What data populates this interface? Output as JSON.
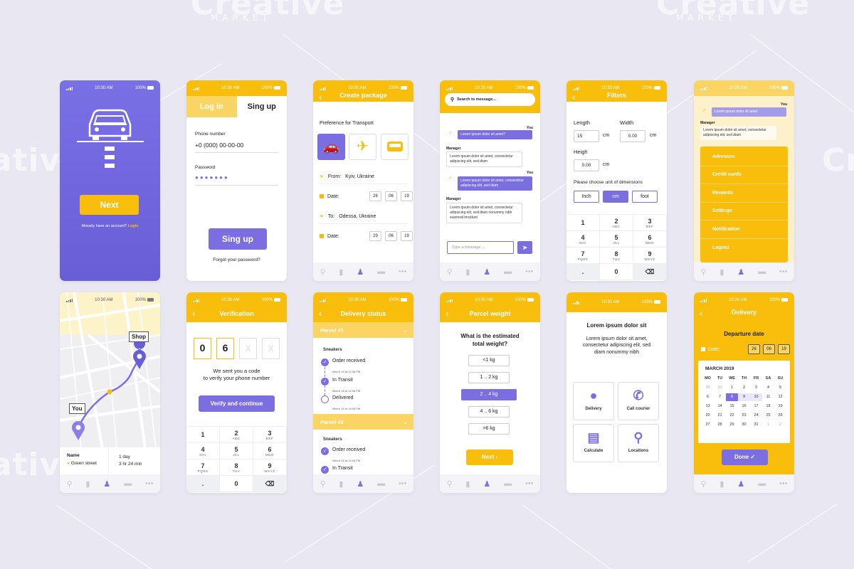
{
  "watermark": {
    "text": "Creative",
    "sub": "MARKET"
  },
  "status_bar": {
    "time": "10:30 AM",
    "battery": "100%"
  },
  "nav_icons": [
    "location-icon",
    "bag-icon",
    "person-icon",
    "car-icon",
    "more-icon"
  ],
  "colors": {
    "yellow": "#f9bd0b",
    "purple": "#7a6ee0",
    "background": "#e9e8f2"
  },
  "s1": {
    "next": "Next",
    "account_text": "Already have an account?",
    "login": "Login"
  },
  "s2": {
    "tab_login": "Log in",
    "tab_signup": "Sing up",
    "phone_label": "Phone number",
    "phone_value": "+0 (000) 00-00-00",
    "password_label": "Password",
    "password_dots": "●●●●●●●",
    "signup_button": "Sing up",
    "forgot": "Forgot your password?"
  },
  "s3": {
    "title": "Create package",
    "pref": "Preference for Transport",
    "from_label": "From:",
    "from_value": "Kyiv, Ukraine",
    "date_label": "Date:",
    "date1": [
      "26",
      "06",
      "19"
    ],
    "to_label": "To:",
    "to_value": "Odessa, Ukraine",
    "date2": [
      "29",
      "06",
      "19"
    ]
  },
  "s4": {
    "search_placeholder": "Search to message...",
    "you": "You",
    "msg_you": "Lorem ipsum dolor sit amet?",
    "manager": "Manager",
    "msg_manager": "Lorem ipsum dolor sit amet, consectetur adipiscing elit, sed diam",
    "you2": "You",
    "msg_you2": "Lorem ipsum dolor sit amet, consectetur adipiscing elit, sed diam",
    "manager2": "Manager",
    "msg_manager2": "Lorem ipsum dolor sit amet, consectetur adipiscing elit, sed diam nonummy nibh euismod tincidunt",
    "input_placeholder": "Type a message ..."
  },
  "s5": {
    "title": "Filters",
    "length_label": "Length",
    "length_value": "15",
    "cm": "cm",
    "width_label": "Width",
    "width_value": "0.00",
    "height_label": "Heigh",
    "height_value": "0.00",
    "units_label": "Please choose unit of dimensions",
    "unit_inch": "Inch",
    "unit_cm": "cm",
    "unit_foot": "foot"
  },
  "keypad": [
    {
      "d": "1",
      "l": ""
    },
    {
      "d": "2",
      "l": "ABC"
    },
    {
      "d": "3",
      "l": "DEF"
    },
    {
      "d": "4",
      "l": "GHI"
    },
    {
      "d": "5",
      "l": "JKL"
    },
    {
      "d": "6",
      "l": "MNO"
    },
    {
      "d": "7",
      "l": "PQRS"
    },
    {
      "d": "8",
      "l": "TUV"
    },
    {
      "d": "9",
      "l": "WXYZ"
    },
    {
      "d": ".",
      "l": ""
    },
    {
      "d": "0",
      "l": ""
    },
    {
      "d": "⌫",
      "l": ""
    }
  ],
  "s6": {
    "you": "You",
    "msg": "Lorem ipsum dolor sit amet",
    "manager": "Manager",
    "msg_manager": "Lorem ipsum dolor sit amet, consectetur adipiscing elit, sed diam",
    "menu": [
      "Adresses",
      "Credit cards",
      "Rewards",
      "Settings",
      "Notification",
      "Logout"
    ]
  },
  "s7": {
    "shop": "Shop",
    "you": "You",
    "name_label": "Name",
    "street": "Green street",
    "duration_day": "1 day",
    "duration_time": "3 hr  24 min"
  },
  "s8": {
    "title": "Verification",
    "code": [
      "0",
      "6",
      "X",
      "X"
    ],
    "msg1": "We sent you a code",
    "msg2": "to verify your phone number",
    "button": "Verify and continue"
  },
  "s9": {
    "title": "Delivery status",
    "parcel1": "Parcel #1",
    "cat1": "Sneakers",
    "steps": [
      {
        "t": "Order received",
        "d": "March 16 at 12:06 PM"
      },
      {
        "t": "In Transit",
        "d": "March 16 at 14:06 PM"
      },
      {
        "t": "Delivered",
        "d": "March 16 at 15:06 PM"
      }
    ],
    "parcel2": "Parcel #2",
    "cat2": "Sneakers",
    "steps2": [
      {
        "t": "Order received",
        "d": "March 16 at 12:06 PM"
      },
      {
        "t": "In Transit",
        "d": ""
      }
    ]
  },
  "s10": {
    "title": "Parcel weight",
    "question1": "What is the estimated",
    "question2": "total weight?",
    "options": [
      "<1 kg",
      "1 .. 2 kg",
      "2 .. 4 kg",
      "4 .. 6 kg",
      ">6 kg"
    ],
    "selected": 2,
    "next": "Next  ›"
  },
  "s11": {
    "heading": "Lorem ipsum dolor sit",
    "text": "Lorem ipsum dolor sit amet, consectetur adipiscing elit, sed diam nonummy nibh",
    "tiles": [
      {
        "label": "Delivery",
        "icon": "globe-icon"
      },
      {
        "label": "Call courier",
        "icon": "phone-icon"
      },
      {
        "label": "Calculate",
        "icon": "calculator-icon"
      },
      {
        "label": "Locations",
        "icon": "location-icon"
      }
    ]
  },
  "s12": {
    "title": "Delivery",
    "subtitle": "Departure date",
    "date_label": "Date:",
    "date": [
      "26",
      "06",
      "19"
    ],
    "month": "MARCH 2019",
    "weekdays": [
      "MO",
      "TU",
      "WE",
      "TH",
      "FR",
      "SA",
      "SU"
    ],
    "days": [
      "30",
      "31",
      "1",
      "2",
      "3",
      "4",
      "5",
      "6",
      "7",
      "8",
      "9",
      "10",
      "11",
      "12",
      "13",
      "14",
      "15",
      "16",
      "17",
      "18",
      "19",
      "20",
      "21",
      "22",
      "23",
      "24",
      "25",
      "26",
      "27",
      "28",
      "29",
      "30",
      "31",
      "1",
      "2"
    ],
    "done": "Done"
  }
}
